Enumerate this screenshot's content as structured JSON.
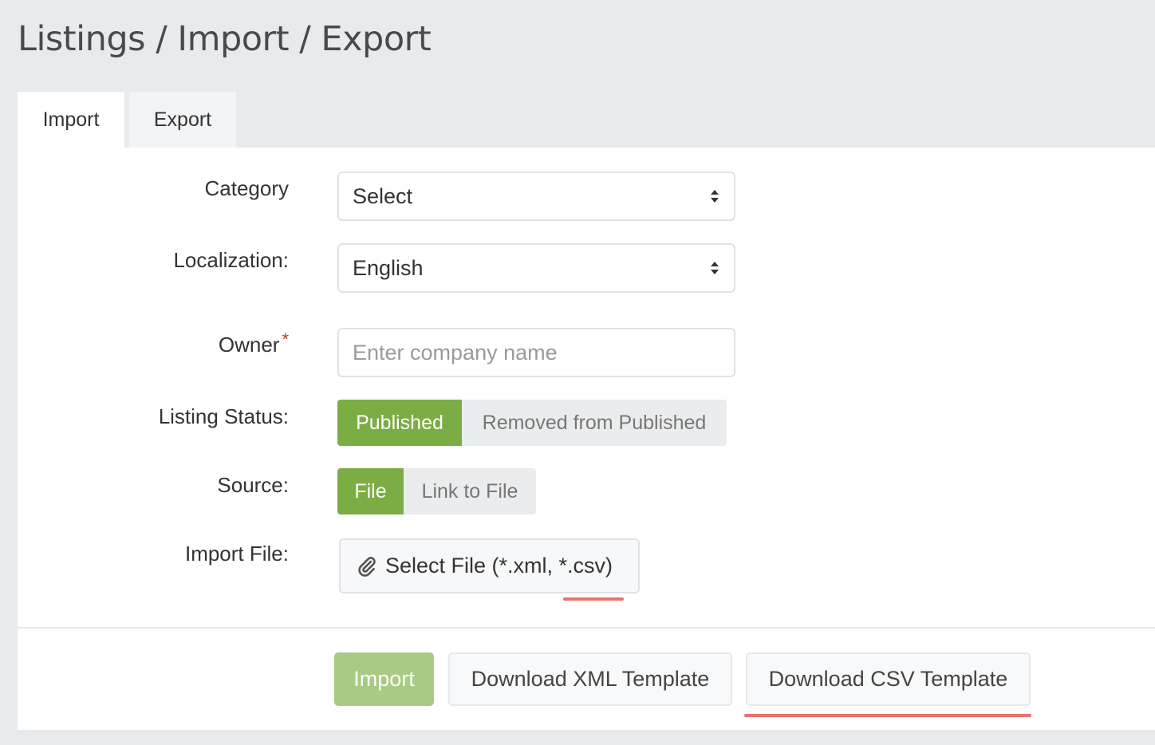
{
  "header": {
    "title": "Listings / Import / Export"
  },
  "tabs": [
    {
      "label": "Import",
      "active": true
    },
    {
      "label": "Export",
      "active": false
    }
  ],
  "form": {
    "category": {
      "label": "Category",
      "value": "Select"
    },
    "localization": {
      "label": "Localization:",
      "value": "English"
    },
    "owner": {
      "label": "Owner",
      "required_mark": "*",
      "placeholder": "Enter company name",
      "value": ""
    },
    "listing_status": {
      "label": "Listing Status:",
      "options": [
        "Published",
        "Removed from Published"
      ],
      "selected": "Published"
    },
    "source": {
      "label": "Source:",
      "options": [
        "File",
        "Link to File"
      ],
      "selected": "File"
    },
    "import_file": {
      "label": "Import File:",
      "button": "Select File (*.xml, *.csv)",
      "icon": "paperclip-icon"
    }
  },
  "actions": {
    "import": "Import",
    "download_xml": "Download XML Template",
    "download_csv": "Download CSV Template"
  },
  "colors": {
    "accent_green": "#7cad45",
    "disabled_green": "#a7cb83",
    "annotation_red": "#e8736e",
    "required_red": "#c0392b"
  }
}
